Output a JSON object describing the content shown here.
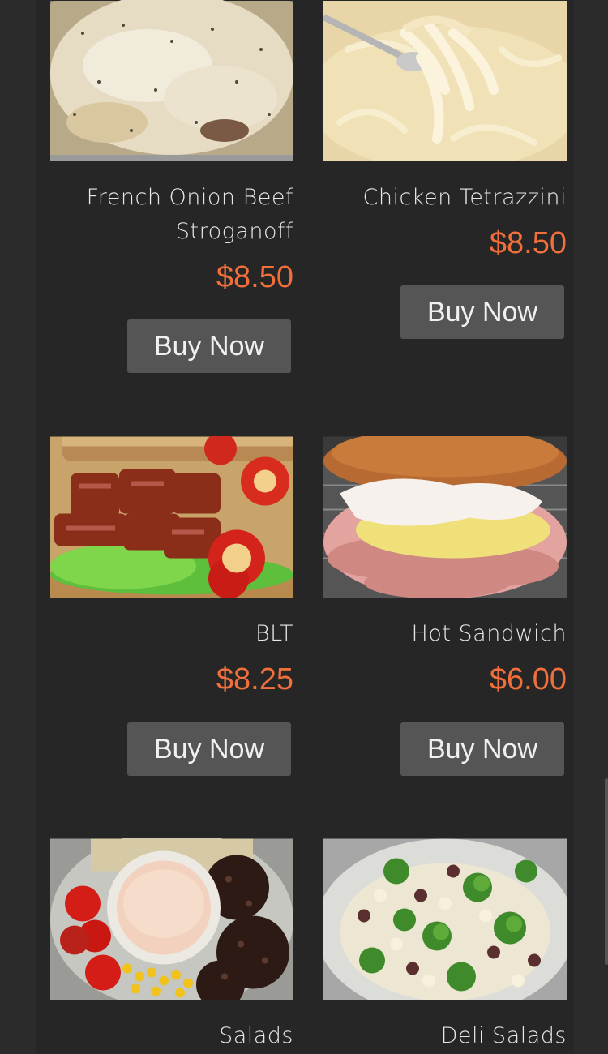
{
  "theme": {
    "accent_price": "#f06f3b",
    "button_bg": "#555555",
    "background": "#262626"
  },
  "products": [
    {
      "name_line1": "French Onion Beef",
      "name_line2": "Stroganoff",
      "price": "$8.50",
      "button": "Buy Now",
      "image": "stroganoff-image"
    },
    {
      "name_line1": "Chicken Tetrazzini",
      "name_line2": "",
      "price": "$8.50",
      "button": "Buy Now",
      "image": "tetrazzini-image"
    },
    {
      "name_line1": "BLT",
      "name_line2": "",
      "price": "$8.25",
      "button": "Buy Now",
      "image": "blt-image"
    },
    {
      "name_line1": "Hot Sandwich",
      "name_line2": "",
      "price": "$6.00",
      "button": "Buy Now",
      "image": "hot-sandwich-image"
    },
    {
      "name_line1": "Salads",
      "name_line2": "",
      "price": "",
      "button": "",
      "image": "salads-image"
    },
    {
      "name_line1": "Deli Salads",
      "name_line2": "",
      "price": "",
      "button": "",
      "image": "deli-salads-image"
    }
  ]
}
